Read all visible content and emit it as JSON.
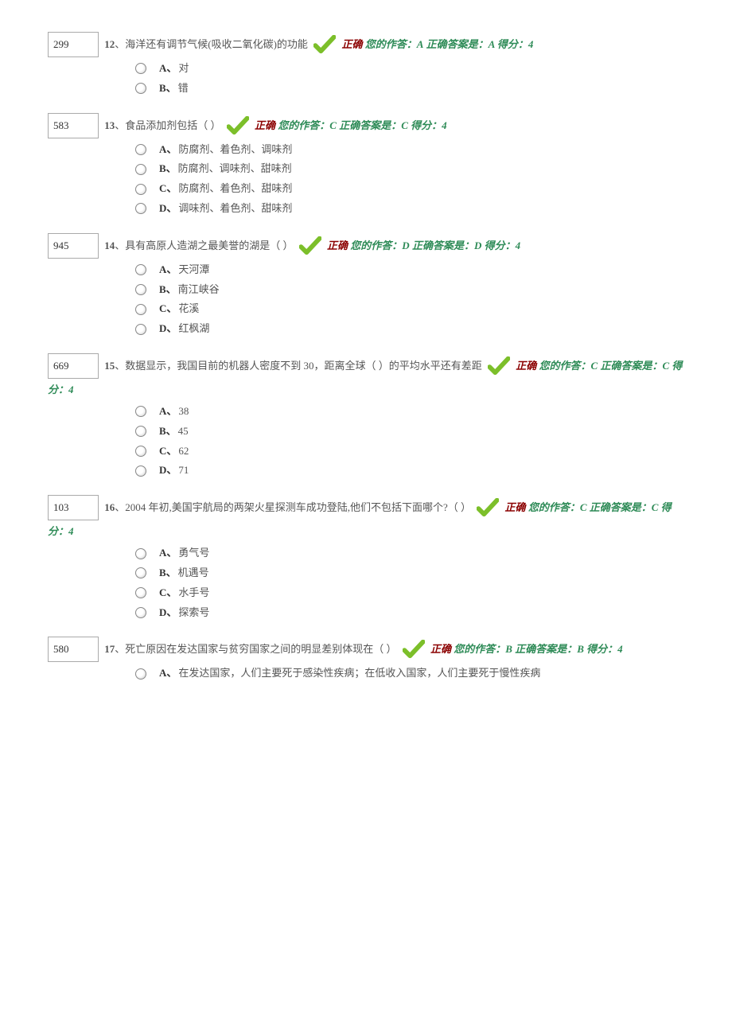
{
  "questions": [
    {
      "id": "299",
      "num": "12",
      "text": "海洋还有调节气候(吸收二氧化碳)的功能",
      "correct_label": "正确",
      "answer_prefix": "您的作答：A",
      "answer_suffix": "正确答案是：A  得分：4",
      "options": [
        {
          "label": "A、",
          "text": "对"
        },
        {
          "label": "B、",
          "text": "错"
        }
      ]
    },
    {
      "id": "583",
      "num": "13",
      "text": "食品添加剂包括（ ）",
      "correct_label": "正确",
      "answer_prefix": "您的作答：C",
      "answer_suffix": "正确答案是：C  得分：4",
      "options": [
        {
          "label": "A、",
          "text": "防腐剂、着色剂、调味剂"
        },
        {
          "label": "B、",
          "text": "防腐剂、调味剂、甜味剂"
        },
        {
          "label": "C、",
          "text": "防腐剂、着色剂、甜味剂"
        },
        {
          "label": "D、",
          "text": "调味剂、着色剂、甜味剂"
        }
      ]
    },
    {
      "id": "945",
      "num": "14",
      "text": "具有高原人造湖之最美誉的湖是（ ）",
      "correct_label": "正确",
      "answer_prefix": "您的作答：D",
      "answer_suffix": "正确答案是：D  得分：4",
      "options": [
        {
          "label": "A、",
          "text": "天河潭"
        },
        {
          "label": "B、",
          "text": "南江峡谷"
        },
        {
          "label": "C、",
          "text": "花溪"
        },
        {
          "label": "D、",
          "text": "红枫湖"
        }
      ]
    },
    {
      "id": "669",
      "num": "15",
      "text": "数据显示，我国目前的机器人密度不到 30，距离全球（ ）的平均水平还有差距",
      "correct_label": "正确",
      "answer_prefix": "您的作答：C",
      "answer_suffix": "正确答案是：C  得分：4",
      "options": [
        {
          "label": "A、",
          "text": "38"
        },
        {
          "label": "B、",
          "text": "45"
        },
        {
          "label": "C、",
          "text": "62"
        },
        {
          "label": "D、",
          "text": "71"
        }
      ]
    },
    {
      "id": "103",
      "num": "16",
      "text": "2004 年初,美国宇航局的两架火星探测车成功登陆,他们不包括下面哪个?（ ）",
      "correct_label": "正确",
      "answer_prefix": "您的作答：C",
      "answer_suffix": "正确答案是：C  得分：4",
      "options": [
        {
          "label": "A、",
          "text": "勇气号"
        },
        {
          "label": "B、",
          "text": "机遇号"
        },
        {
          "label": "C、",
          "text": "水手号"
        },
        {
          "label": "D、",
          "text": "探索号"
        }
      ]
    },
    {
      "id": "580",
      "num": "17",
      "text": "死亡原因在发达国家与贫穷国家之间的明显差别体现在（ ）",
      "correct_label": "正确",
      "answer_prefix": "您的作答：B",
      "answer_suffix": "正确答案是：B  得分：4",
      "options": [
        {
          "label": "A、",
          "text": "在发达国家，人们主要死于感染性疾病；在低收入国家，人们主要死于慢性疾病"
        }
      ]
    }
  ]
}
